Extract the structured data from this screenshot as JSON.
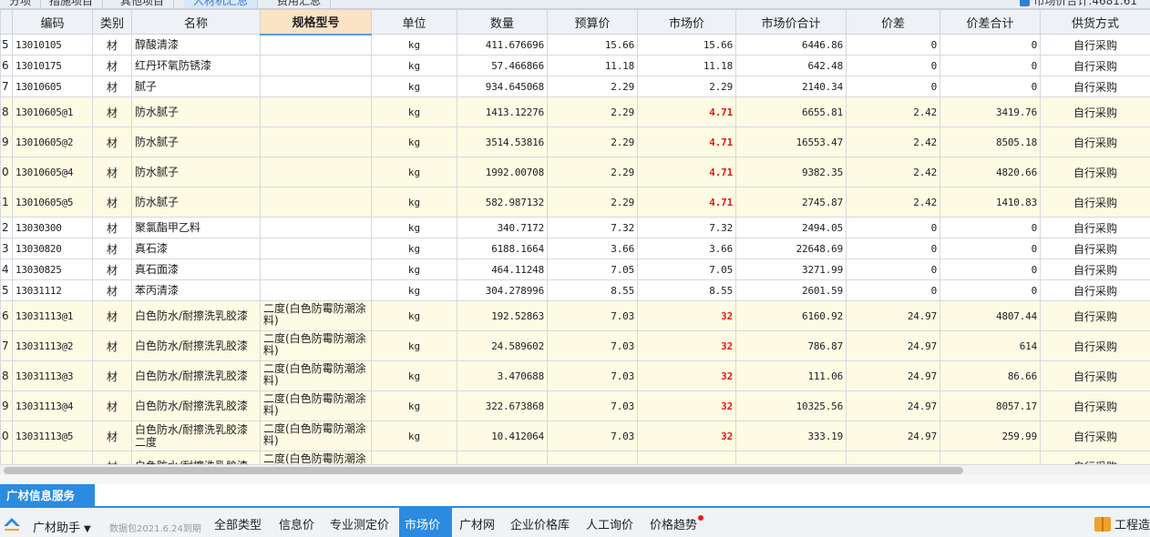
{
  "top_tabs": [
    {
      "label": "分项",
      "active": false
    },
    {
      "label": "措施项目",
      "active": false
    },
    {
      "label": "其他项目",
      "active": false
    },
    {
      "label": "人材机汇总",
      "active": true
    },
    {
      "label": "费用汇总",
      "active": false
    }
  ],
  "top_right": {
    "label": "市场价合计",
    "value": ":4681.61",
    "checked": true
  },
  "columns": [
    "编码",
    "类别",
    "名称",
    "规格型号",
    "单位",
    "数量",
    "预算价",
    "市场价",
    "市场价合计",
    "价差",
    "价差合计",
    "供货方式"
  ],
  "rows": [
    {
      "rn": "5",
      "code": "13010105",
      "cat": "材",
      "name": "醇酸清漆",
      "spec": "",
      "unit": "kg",
      "qty": "411.676696",
      "budget": "15.66",
      "market": "15.66",
      "market_total": "6446.86",
      "diff": "0",
      "diff_total": "0",
      "supply": "自行采购",
      "hl": false
    },
    {
      "rn": "6",
      "code": "13010175",
      "cat": "材",
      "name": "红丹环氧防锈漆",
      "spec": "",
      "unit": "kg",
      "qty": "57.466866",
      "budget": "11.18",
      "market": "11.18",
      "market_total": "642.48",
      "diff": "0",
      "diff_total": "0",
      "supply": "自行采购",
      "hl": false
    },
    {
      "rn": "7",
      "code": "13010605",
      "cat": "材",
      "name": "腻子",
      "spec": "",
      "unit": "kg",
      "qty": "934.645068",
      "budget": "2.29",
      "market": "2.29",
      "market_total": "2140.34",
      "diff": "0",
      "diff_total": "0",
      "supply": "自行采购",
      "hl": false
    },
    {
      "rn": "8",
      "code": "13010605@1",
      "cat": "材",
      "name": "防水腻子",
      "spec": "",
      "unit": "kg",
      "qty": "1413.12276",
      "budget": "2.29",
      "market": "4.71",
      "market_total": "6655.81",
      "diff": "2.42",
      "diff_total": "3419.76",
      "supply": "自行采购",
      "hl": true
    },
    {
      "rn": "9",
      "code": "13010605@2",
      "cat": "材",
      "name": "防水腻子",
      "spec": "",
      "unit": "kg",
      "qty": "3514.53816",
      "budget": "2.29",
      "market": "4.71",
      "market_total": "16553.47",
      "diff": "2.42",
      "diff_total": "8505.18",
      "supply": "自行采购",
      "hl": true
    },
    {
      "rn": "0",
      "code": "13010605@4",
      "cat": "材",
      "name": "防水腻子",
      "spec": "",
      "unit": "kg",
      "qty": "1992.00708",
      "budget": "2.29",
      "market": "4.71",
      "market_total": "9382.35",
      "diff": "2.42",
      "diff_total": "4820.66",
      "supply": "自行采购",
      "hl": true
    },
    {
      "rn": "1",
      "code": "13010605@5",
      "cat": "材",
      "name": "防水腻子",
      "spec": "",
      "unit": "kg",
      "qty": "582.987132",
      "budget": "2.29",
      "market": "4.71",
      "market_total": "2745.87",
      "diff": "2.42",
      "diff_total": "1410.83",
      "supply": "自行采购",
      "hl": true
    },
    {
      "rn": "2",
      "code": "13030300",
      "cat": "材",
      "name": "聚氯酯甲乙料",
      "spec": "",
      "unit": "kg",
      "qty": "340.7172",
      "budget": "7.32",
      "market": "7.32",
      "market_total": "2494.05",
      "diff": "0",
      "diff_total": "0",
      "supply": "自行采购",
      "hl": false
    },
    {
      "rn": "3",
      "code": "13030820",
      "cat": "材",
      "name": "真石漆",
      "spec": "",
      "unit": "kg",
      "qty": "6188.1664",
      "budget": "3.66",
      "market": "3.66",
      "market_total": "22648.69",
      "diff": "0",
      "diff_total": "0",
      "supply": "自行采购",
      "hl": false
    },
    {
      "rn": "4",
      "code": "13030825",
      "cat": "材",
      "name": "真石面漆",
      "spec": "",
      "unit": "kg",
      "qty": "464.11248",
      "budget": "7.05",
      "market": "7.05",
      "market_total": "3271.99",
      "diff": "0",
      "diff_total": "0",
      "supply": "自行采购",
      "hl": false
    },
    {
      "rn": "5",
      "code": "13031112",
      "cat": "材",
      "name": "苯丙清漆",
      "spec": "",
      "unit": "kg",
      "qty": "304.278996",
      "budget": "8.55",
      "market": "8.55",
      "market_total": "2601.59",
      "diff": "0",
      "diff_total": "0",
      "supply": "自行采购",
      "hl": false
    },
    {
      "rn": "6",
      "code": "13031113@1",
      "cat": "材",
      "name": "白色防水/耐擦洗乳胶漆",
      "spec": "二度(白色防霉防潮涂料)",
      "unit": "kg",
      "qty": "192.52863",
      "budget": "7.03",
      "market": "32",
      "market_total": "6160.92",
      "diff": "24.97",
      "diff_total": "4807.44",
      "supply": "自行采购",
      "hl": true
    },
    {
      "rn": "7",
      "code": "13031113@2",
      "cat": "材",
      "name": "白色防水/耐擦洗乳胶漆",
      "spec": "二度(白色防霉防潮涂料)",
      "unit": "kg",
      "qty": "24.589602",
      "budget": "7.03",
      "market": "32",
      "market_total": "786.87",
      "diff": "24.97",
      "diff_total": "614",
      "supply": "自行采购",
      "hl": true
    },
    {
      "rn": "8",
      "code": "13031113@3",
      "cat": "材",
      "name": "白色防水/耐擦洗乳胶漆",
      "spec": "二度(白色防霉防潮涂料)",
      "unit": "kg",
      "qty": "3.470688",
      "budget": "7.03",
      "market": "32",
      "market_total": "111.06",
      "diff": "24.97",
      "diff_total": "86.66",
      "supply": "自行采购",
      "hl": true
    },
    {
      "rn": "9",
      "code": "13031113@4",
      "cat": "材",
      "name": "白色防水/耐擦洗乳胶漆",
      "spec": "二度(白色防霉防潮涂料)",
      "unit": "kg",
      "qty": "322.673868",
      "budget": "7.03",
      "market": "32",
      "market_total": "10325.56",
      "diff": "24.97",
      "diff_total": "8057.17",
      "supply": "自行采购",
      "hl": true
    },
    {
      "rn": "0",
      "code": "13031113@5",
      "cat": "材",
      "name": "白色防水/耐擦洗乳胶漆二度",
      "spec": "二度(白色防霉防潮涂料)",
      "unit": "kg",
      "qty": "10.412064",
      "budget": "7.03",
      "market": "32",
      "market_total": "333.19",
      "diff": "24.97",
      "diff_total": "259.99",
      "supply": "自行采购",
      "hl": true
    },
    {
      "rn": "",
      "code": "",
      "cat": "材",
      "name": "白色防水/耐擦洗乳胶漆",
      "spec": "二度(白色防霉防潮涂",
      "unit": "",
      "qty": "",
      "budget": "",
      "market": "",
      "market_total": "",
      "diff": "",
      "diff_total": "",
      "supply": "自行采购",
      "hl": true
    }
  ],
  "service_panel": {
    "title": "广材信息服务"
  },
  "toolbar": {
    "helper_label": "广材助手",
    "package_info": "数据包2021.6.24到期",
    "tabs": [
      {
        "label": "全部类型",
        "active": false,
        "dot": false
      },
      {
        "label": "信息价",
        "active": false,
        "dot": false
      },
      {
        "label": "专业测定价",
        "active": false,
        "dot": false
      },
      {
        "label": "市场价",
        "active": true,
        "dot": false
      },
      {
        "label": "广材网",
        "active": false,
        "dot": false
      },
      {
        "label": "企业价格库",
        "active": false,
        "dot": false
      },
      {
        "label": "人工询价",
        "active": false,
        "dot": false
      },
      {
        "label": "价格趋势",
        "active": false,
        "dot": true
      }
    ],
    "right_label": "工程造"
  },
  "colors": {
    "highlight_row": "#fdfbe3",
    "red_price": "#e01818",
    "accent": "#2b8be0",
    "header_highlight": "#fbe3c6"
  }
}
